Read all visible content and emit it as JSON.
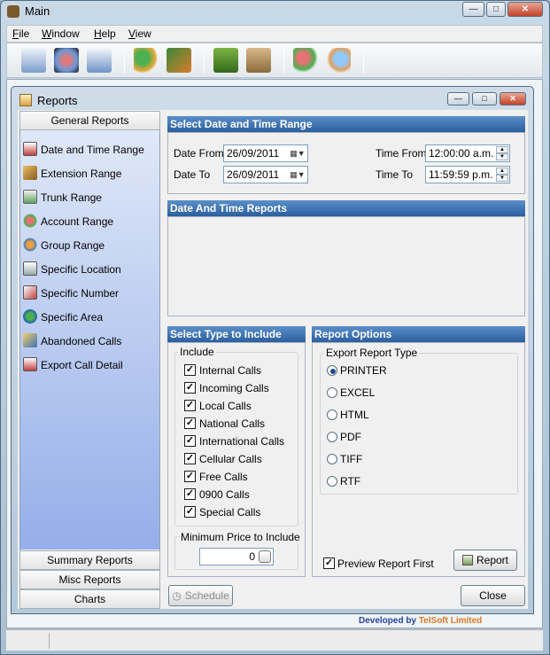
{
  "app": {
    "title": "Main"
  },
  "window_controls": {
    "minimize": "—",
    "maximize": "□",
    "close": "✕"
  },
  "menu": [
    {
      "key": "F",
      "rest": "ile"
    },
    {
      "key": "W",
      "rest": "indow"
    },
    {
      "key": "H",
      "rest": "elp"
    },
    {
      "key": "V",
      "rest": "iew"
    }
  ],
  "reports_window": {
    "title": "Reports"
  },
  "left_panel": {
    "header": "General Reports",
    "items": [
      "Date and Time Range",
      "Extension Range",
      "Trunk Range",
      "Account Range",
      "Group Range",
      "Specific Location",
      "Specific Number",
      "Specific Area",
      "Abandoned Calls",
      "Export Call Detail"
    ],
    "footers": [
      "Summary Reports",
      "Misc Reports",
      "Charts"
    ]
  },
  "date_range": {
    "header": "Select Date and Time Range",
    "date_from_label": "Date From",
    "date_from": "26/09/2011",
    "date_to_label": "Date To",
    "date_to": "26/09/2011",
    "time_from_label": "Time From",
    "time_from": "12:00:00 a.m.",
    "time_to_label": "Time To",
    "time_to": "11:59:59 p.m."
  },
  "reports_section": {
    "header": "Date And Time Reports"
  },
  "include": {
    "header": "Select Type to Include",
    "group_label": "Include",
    "items": [
      {
        "label": "Internal Calls",
        "checked": true
      },
      {
        "label": "Incoming Calls",
        "checked": true
      },
      {
        "label": "Local Calls",
        "checked": true
      },
      {
        "label": "National Calls",
        "checked": true
      },
      {
        "label": "International Calls",
        "checked": true
      },
      {
        "label": "Cellular Calls",
        "checked": true
      },
      {
        "label": "Free Calls",
        "checked": true
      },
      {
        "label": "0900 Calls",
        "checked": true
      },
      {
        "label": "Special Calls",
        "checked": true
      }
    ],
    "min_price_label": "Minimum Price to Include",
    "min_price": "0"
  },
  "report_options": {
    "header": "Report Options",
    "export_label": "Export Report Type",
    "types": [
      "PRINTER",
      "EXCEL",
      "HTML",
      "PDF",
      "TIFF",
      "RTF"
    ],
    "selected": "PRINTER",
    "preview_label": "Preview Report First",
    "preview_checked": true,
    "report_button": "Report"
  },
  "buttons": {
    "schedule": "Schedule",
    "close": "Close"
  },
  "branding": {
    "prefix": "Developed by",
    "company": "TelSoft Limited"
  },
  "glyphs": {
    "check": "✓",
    "dropdown": "▼",
    "calendar": "▦",
    "up": "▲",
    "down": "▼",
    "clock": "◷"
  },
  "colors": {
    "panel_header": "#2b5f9e",
    "left_gradient_bottom": "#95aee9",
    "brand_blue": "#2b3f9e",
    "brand_orange": "#e07820"
  }
}
